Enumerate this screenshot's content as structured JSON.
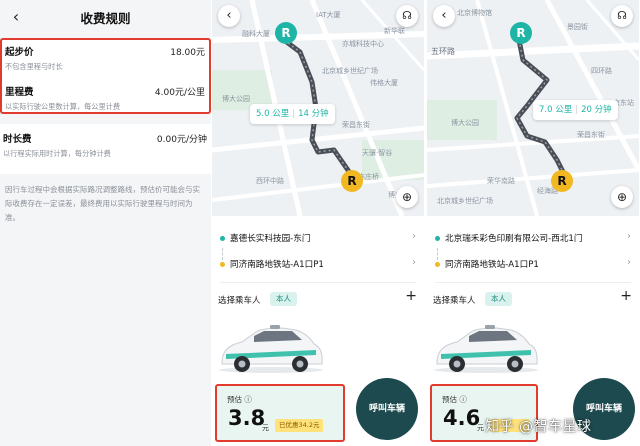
{
  "fee_rules": {
    "title": "收费规则",
    "start_fee": {
      "label": "起步价",
      "value": "18.00元",
      "note": "不包含里程与时长"
    },
    "mileage_fee": {
      "label": "里程费",
      "value": "4.00元/公里",
      "note": "以实际行驶公里数计算，每公里计费"
    },
    "duration_fee": {
      "label": "时长费",
      "value": "0.00元/分钟",
      "note": "以行程实际用时计算，每分钟计费"
    },
    "disclaimer": "因行车过程中会根据实际路况调整路线，预估价可能会与实际收费存在一定误差，最终费用以实际行驶里程与时间为准。"
  },
  "trip_a": {
    "map_labels": [
      "IAT大厦",
      "融科大厦",
      "北京城乡世纪广场",
      "亦城科技中心",
      "新华联",
      "伟格大厦",
      "博大公园",
      "荣昌东街",
      "天骥·智谷",
      "西环中路",
      "博兴四路",
      "亦庄桥"
    ],
    "distance": "5.0 公里",
    "duration": "14 分钟",
    "origin": "嘉德长实科技园-东门",
    "destination": "同济南路地铁站-A1口P1",
    "rider_label": "选择乘车人",
    "rider_chip": "本人",
    "estimate_label": "预估",
    "estimate_value": "3.8",
    "currency": "元",
    "discount": "已优惠34.2元",
    "call_button": "呼叫车辆"
  },
  "trip_b": {
    "map_labels": [
      "五环路",
      "博大公园",
      "荣昌东街",
      "景园街",
      "京东站",
      "经海路",
      "荣华南路",
      "北京博物馆",
      "北京城乡世纪广场",
      "四环路"
    ],
    "distance": "7.0 公里",
    "duration": "20 分钟",
    "origin": "北京瑞禾彩色印刷有限公司-西北1门",
    "destination": "同济南路地铁站-A1口P1",
    "rider_label": "选择乘车人",
    "rider_chip": "本人",
    "estimate_label": "预估",
    "estimate_value": "4.6",
    "currency": "元",
    "call_button": "呼叫车辆"
  },
  "watermark": "知乎 @智车星球",
  "colors": {
    "accent": "#1fb5a6",
    "highlight": "#e23b2e",
    "end_pin": "#f2b822",
    "call": "#1c4a4f"
  }
}
